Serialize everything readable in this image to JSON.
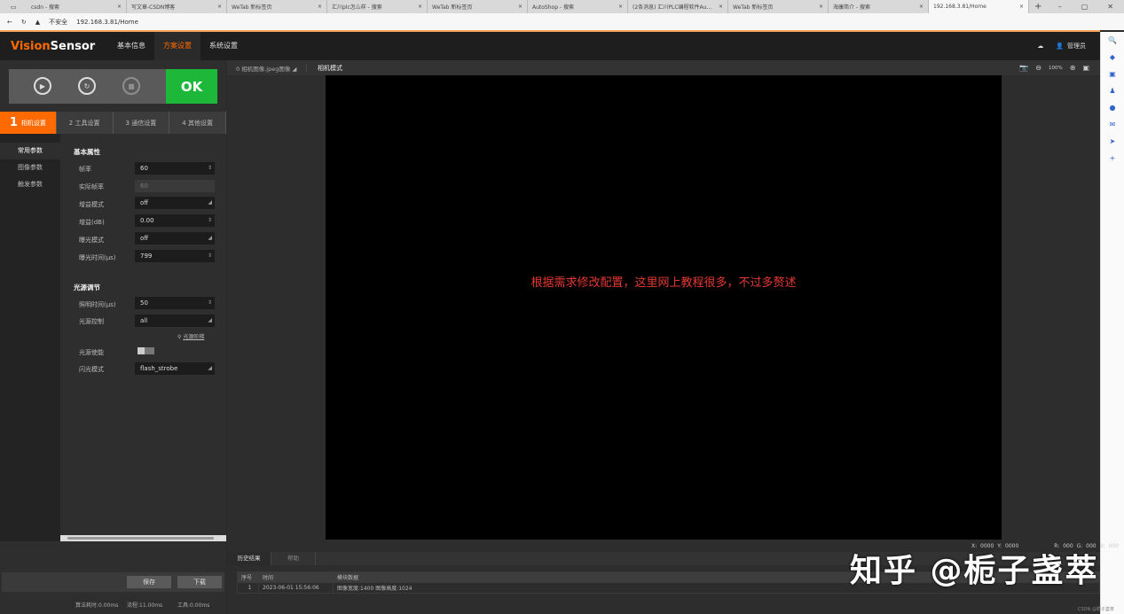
{
  "browser": {
    "tabs": [
      {
        "label": "csdn - 搜索"
      },
      {
        "label": "写文章-CSDN博客"
      },
      {
        "label": "WeTab 新标签页"
      },
      {
        "label": "汇川plc怎么样 - 搜索"
      },
      {
        "label": "WeTab 新标签页"
      },
      {
        "label": "AutoShop - 搜索"
      },
      {
        "label": "(2条消息) 汇川PLC编程软件Au..."
      },
      {
        "label": "WeTab 新标签页"
      },
      {
        "label": "海康简介 - 搜索"
      },
      {
        "label": "192.168.3.81/Home"
      }
    ],
    "insecure": "不安全",
    "url": "192.168.3.81/Home"
  },
  "header": {
    "logo_a": "Vision",
    "logo_b": "Sensor",
    "nav": [
      "基本信息",
      "方案设置",
      "系统设置"
    ],
    "user": "管理员"
  },
  "control": {
    "ok": "OK"
  },
  "steps": [
    {
      "num": "1",
      "label": "相机设置"
    },
    {
      "label": "2 工具设置"
    },
    {
      "label": "3 通信设置"
    },
    {
      "label": "4 其他设置"
    }
  ],
  "subnav": [
    "常用参数",
    "图像参数",
    "触发参数"
  ],
  "form": {
    "basic_title": "基本属性",
    "light_title": "光源调节",
    "fields": [
      {
        "label": "帧率",
        "value": "60"
      },
      {
        "label": "实际帧率",
        "value": "60"
      },
      {
        "label": "增益模式",
        "value": "off"
      },
      {
        "label": "增益(dB)",
        "value": "0.00"
      },
      {
        "label": "曝光模式",
        "value": "off"
      },
      {
        "label": "曝光时间(μs)",
        "value": "799"
      },
      {
        "label": "照明时间(μs)",
        "value": "50"
      },
      {
        "label": "光源控制",
        "value": "all"
      },
      {
        "label": "光源使能",
        "value": ""
      },
      {
        "label": "闪光模式",
        "value": "flash_strobe"
      }
    ],
    "light_link": "光源阶梯"
  },
  "buttons": {
    "save": "保存",
    "download": "下载"
  },
  "status": {
    "algo": "算法耗时:0.00ms",
    "cycle": "流程:11.00ms",
    "tool": "工具:0.00ms"
  },
  "viewer": {
    "image_tab": "0 相机图像.jpeg图像",
    "mode_tab": "相机模式",
    "zoom": "100%",
    "annotation": "根据需求修改配置，这里网上教程很多，不过多赘述",
    "coords": "X: 0000  Y: 0000",
    "rgb": "R: 000  G: 000  B: 000"
  },
  "history": {
    "tabs": [
      "历史结果",
      "帮助"
    ],
    "columns": [
      "序号",
      "时间",
      "模块数据"
    ],
    "rows": [
      [
        "1",
        "2023-06-01 15:56:06",
        "图像宽度:1400 图像高度:1024"
      ]
    ]
  },
  "watermark": "知乎 @栀子盏萃",
  "csdn": "CSDN @栀子盏萃"
}
